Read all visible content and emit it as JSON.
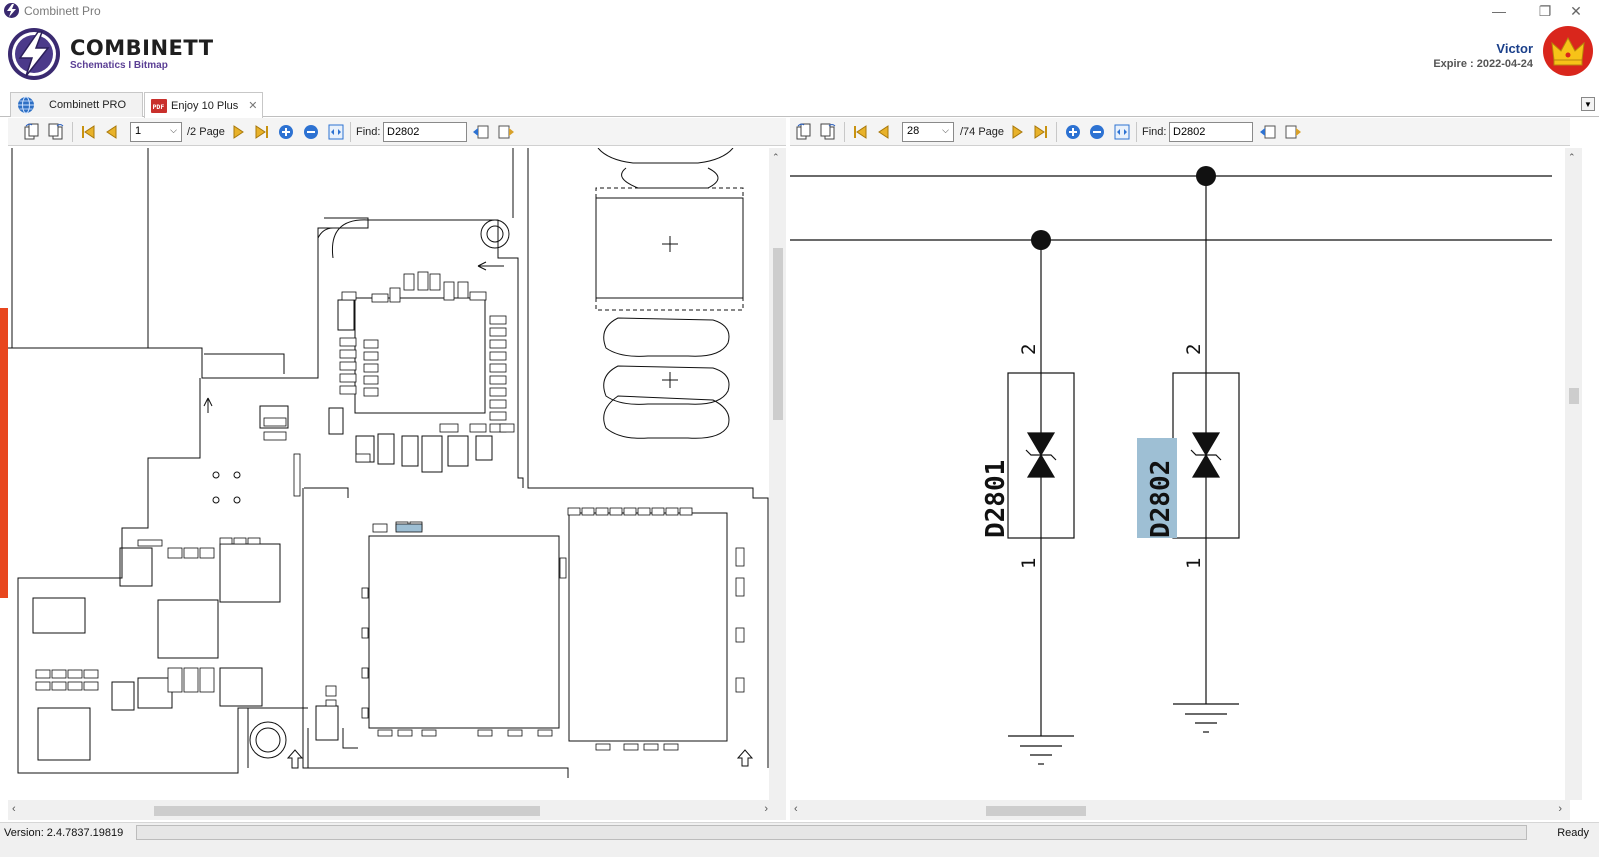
{
  "window": {
    "title": "Combinett Pro"
  },
  "brand": {
    "name": "COMBINETT",
    "tagline": "Schematics I Bitmap"
  },
  "user": {
    "name": "Victor",
    "expire": "Expire : 2022-04-24"
  },
  "tabs": [
    {
      "label": "Combinett PRO",
      "icon": "globe-icon",
      "active": false
    },
    {
      "label": "Enjoy 10 Plus",
      "icon": "pdf-icon",
      "active": true
    }
  ],
  "left_pane": {
    "page_value": "1",
    "page_total": "/2 Page",
    "find_label": "Find:",
    "find_value": "D2802"
  },
  "right_pane": {
    "page_value": "28",
    "page_total": "/74 Page",
    "find_label": "Find:",
    "find_value": "D2802",
    "schematic": {
      "components": [
        {
          "ref": "D2801",
          "pin_top": "2",
          "pin_bottom": "1",
          "highlighted": false
        },
        {
          "ref": "D2802",
          "pin_top": "2",
          "pin_bottom": "1",
          "highlighted": true
        }
      ]
    }
  },
  "status": {
    "version": "Version: 2.4.7837.19819",
    "ready": "Ready"
  },
  "colors": {
    "accent_red": "#d9261c",
    "brand_purple": "#3a2a70",
    "highlight": "#9ebfd4",
    "link_blue": "#1a3f8a"
  }
}
